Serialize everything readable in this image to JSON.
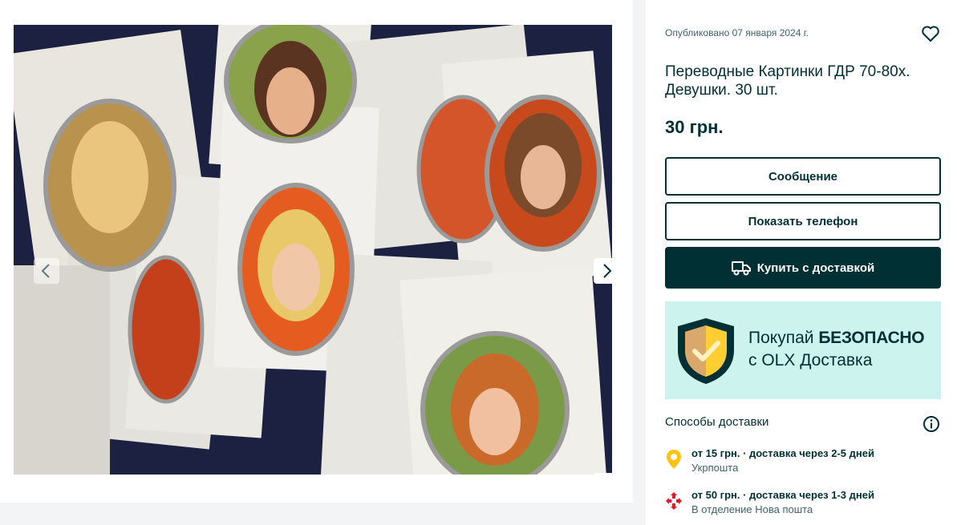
{
  "listing": {
    "published": "Опубликовано 07 января 2024 г.",
    "title": "Переводные Картинки ГДР 70-80х. Девушки. 30 шт.",
    "price": "30 грн."
  },
  "actions": {
    "message_label": "Сообщение",
    "phone_label": "Показать телефон",
    "buy_label": "Купить с доставкой"
  },
  "banner": {
    "line1_prefix": "Покупай ",
    "line1_bold": "БЕЗОПАСНО",
    "line2": "с OLX Доставка"
  },
  "delivery": {
    "title": "Способы доставки",
    "options": [
      {
        "price_time": "от 15 грн. · доставка через 2-5 дней",
        "carrier": "Укрпошта",
        "icon": "ukrposhta-pin-icon"
      },
      {
        "price_time": "от 50 грн. · доставка через 1-3 дней",
        "carrier": "В отделение Нова пошта",
        "icon": "nova-poshta-icon"
      }
    ]
  },
  "gallery": {
    "photo_count": 6,
    "active_index": 0
  },
  "colors": {
    "brand_dark": "#002f34",
    "banner_bg": "#cdf3ee",
    "shield_yellow": "#ffce32",
    "nova_poshta_red": "#e3172a"
  }
}
